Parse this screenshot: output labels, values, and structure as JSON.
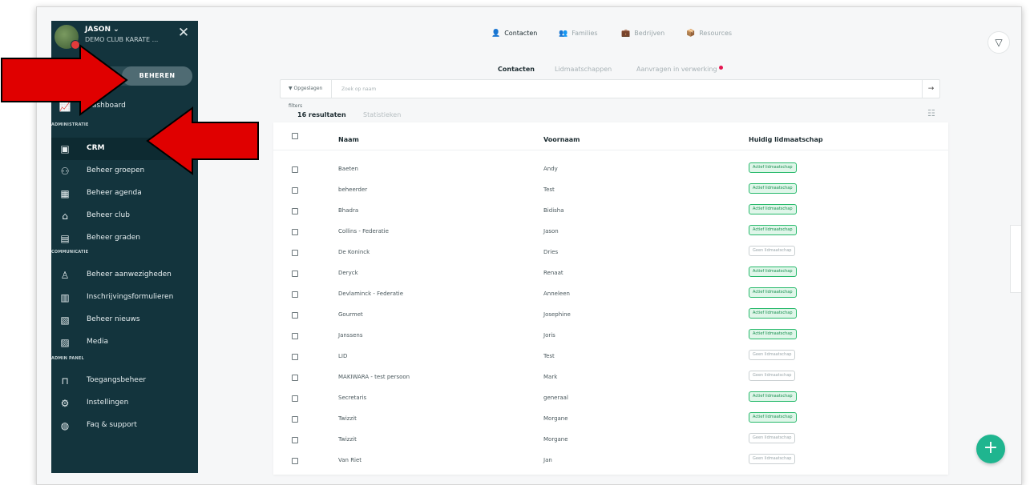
{
  "sidebar": {
    "user_name": "JASON ⌄",
    "club_name": "DEMO CLUB KARATE ...",
    "close_icon": "close-icon",
    "mode_active": "BEHEREN",
    "dashboard": "Dashboard",
    "sections": {
      "administratie": "ADMINISTRATIE",
      "communicatie": "COMMUNICATIE",
      "admin_panel": "ADMIN PANEL"
    },
    "items": [
      {
        "label": "CRM",
        "icon": "contact-card-icon"
      },
      {
        "label": "Beheer groepen",
        "icon": "group-icon"
      },
      {
        "label": "Beheer agenda",
        "icon": "calendar-icon"
      },
      {
        "label": "Beheer club",
        "icon": "building-icon"
      },
      {
        "label": "Beheer graden",
        "icon": "grade-icon"
      },
      {
        "label": "Beheer aanwezigheden",
        "icon": "user-check-icon"
      },
      {
        "label": "Inschrijvingsformulieren",
        "icon": "clipboard-icon"
      },
      {
        "label": "Beheer nieuws",
        "icon": "news-icon"
      },
      {
        "label": "Media",
        "icon": "media-icon"
      },
      {
        "label": "Toegangsbeheer",
        "icon": "lock-icon"
      },
      {
        "label": "Instellingen",
        "icon": "gear-icon"
      },
      {
        "label": "Faq & support",
        "icon": "support-icon"
      }
    ]
  },
  "topnav": {
    "contacten": "Contacten",
    "families": "Families",
    "bedrijven": "Bedrijven",
    "resources": "Resources"
  },
  "subtabs": {
    "contacten": "Contacten",
    "lidmaatschappen": "Lidmaatschappen",
    "aanvragen": "Aanvragen in verwerking"
  },
  "search": {
    "saved_filters": "Opgeslagen filters",
    "placeholder": "Zoek op naam"
  },
  "results_tabs": {
    "results": "16 resultaten",
    "stats": "Statistieken"
  },
  "table": {
    "headers": {
      "naam": "Naam",
      "voornaam": "Voornaam",
      "lidmaatschap": "Huidig lidmaatschap"
    },
    "rows": [
      {
        "naam": "Baeten",
        "voornaam": "Andy",
        "status": "Actief lidmaatschap",
        "active": true
      },
      {
        "naam": "beheerder",
        "voornaam": "Test",
        "status": "Actief lidmaatschap",
        "active": true
      },
      {
        "naam": "Bhadra",
        "voornaam": "Bidisha",
        "status": "Actief lidmaatschap",
        "active": true
      },
      {
        "naam": "Collins - Federatie",
        "voornaam": "Jason",
        "status": "Actief lidmaatschap",
        "active": true
      },
      {
        "naam": "De Koninck",
        "voornaam": "Dries",
        "status": "Geen lidmaatschap",
        "active": false
      },
      {
        "naam": "Deryck",
        "voornaam": "Renaat",
        "status": "Actief lidmaatschap",
        "active": true
      },
      {
        "naam": "Devlaminck - Federatie",
        "voornaam": "Anneleen",
        "status": "Actief lidmaatschap",
        "active": true
      },
      {
        "naam": "Gourmet",
        "voornaam": "Josephine",
        "status": "Actief lidmaatschap",
        "active": true
      },
      {
        "naam": "Janssens",
        "voornaam": "Joris",
        "status": "Actief lidmaatschap",
        "active": true
      },
      {
        "naam": "LID",
        "voornaam": "Test",
        "status": "Geen lidmaatschap",
        "active": false
      },
      {
        "naam": "MAKIWARA - test persoon",
        "voornaam": "Mark",
        "status": "Geen lidmaatschap",
        "active": false
      },
      {
        "naam": "Secretaris",
        "voornaam": "generaal",
        "status": "Actief lidmaatschap",
        "active": true
      },
      {
        "naam": "Twizzit",
        "voornaam": "Morgane",
        "status": "Actief lidmaatschap",
        "active": true
      },
      {
        "naam": "Twizzit",
        "voornaam": "Morgane",
        "status": "Geen lidmaatschap",
        "active": false
      },
      {
        "naam": "Van Riet",
        "voornaam": "Jan",
        "status": "Geen lidmaatschap",
        "active": false
      }
    ]
  },
  "colors": {
    "sidebar_bg": "#13343d",
    "active_badge": "#27b96b",
    "fab": "#1fb58f",
    "notification_dot": "#e3154f",
    "annotation_arrow": "#e00000"
  }
}
